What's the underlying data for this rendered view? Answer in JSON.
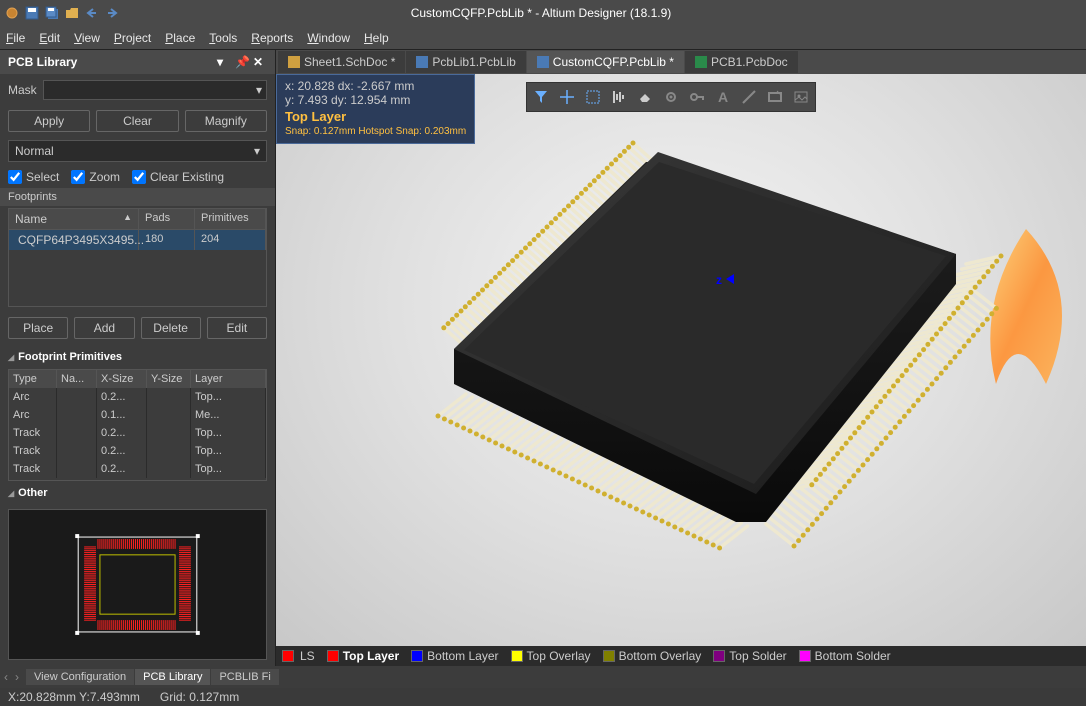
{
  "title_bar": {
    "title": "CustomCQFP.PcbLib * - Altium Designer (18.1.9)"
  },
  "menus": [
    "File",
    "Edit",
    "View",
    "Project",
    "Place",
    "Tools",
    "Reports",
    "Window",
    "Help"
  ],
  "panel": {
    "title": "PCB Library",
    "mask_label": "Mask",
    "apply": "Apply",
    "clear": "Clear",
    "magnify": "Magnify",
    "normal": "Normal",
    "select": "Select",
    "zoom": "Zoom",
    "clear_existing": "Clear Existing",
    "footprints_label": "Footprints",
    "columns": {
      "name": "Name",
      "pads": "Pads",
      "prims": "Primitives"
    },
    "footprint_row": {
      "name": "CQFP64P3495X3495...",
      "pads": "180",
      "prims": "204"
    },
    "actions": {
      "place": "Place",
      "add": "Add",
      "delete": "Delete",
      "edit": "Edit"
    },
    "prim_title": "Footprint Primitives",
    "prim_cols": {
      "type": "Type",
      "name": "Na...",
      "xsize": "X-Size",
      "ysize": "Y-Size",
      "layer": "Layer"
    },
    "prim_rows": [
      {
        "type": "Arc",
        "name": "",
        "xsize": "0.2...",
        "ysize": "",
        "layer": "Top..."
      },
      {
        "type": "Arc",
        "name": "",
        "xsize": "0.1...",
        "ysize": "",
        "layer": "Me..."
      },
      {
        "type": "Track",
        "name": "",
        "xsize": "0.2...",
        "ysize": "",
        "layer": "Top..."
      },
      {
        "type": "Track",
        "name": "",
        "xsize": "0.2...",
        "ysize": "",
        "layer": "Top..."
      },
      {
        "type": "Track",
        "name": "",
        "xsize": "0.2...",
        "ysize": "",
        "layer": "Top..."
      }
    ],
    "other_title": "Other"
  },
  "tabs": [
    {
      "label": "Sheet1.SchDoc *",
      "active": false
    },
    {
      "label": "PcbLib1.PcbLib",
      "active": false
    },
    {
      "label": "CustomCQFP.PcbLib *",
      "active": true
    },
    {
      "label": "PCB1.PcbDoc",
      "active": false
    }
  ],
  "info": {
    "line1": "x: 20.828    dx: -2.667   mm",
    "line2": "y:  7.493    dy: 12.954  mm",
    "top_layer": "Top Layer",
    "snap": "Snap: 0.127mm Hotspot Snap: 0.203mm"
  },
  "bottom_tabs": {
    "view_config": "View Configuration",
    "pcb_lib": "PCB Library",
    "pcblib_fi": "PCBLIB Fi"
  },
  "layers": {
    "ls": "LS",
    "items": [
      {
        "color": "#ff0000",
        "label": "Top Layer",
        "bold": true
      },
      {
        "color": "#0000ff",
        "label": "Bottom Layer"
      },
      {
        "color": "#ffff00",
        "label": "Top Overlay"
      },
      {
        "color": "#808000",
        "label": "Bottom Overlay"
      },
      {
        "color": "#800080",
        "label": "Top Solder"
      },
      {
        "color": "#ff00ff",
        "label": "Bottom Solder"
      }
    ]
  },
  "status": {
    "xy": "X:20.828mm Y:7.493mm",
    "grid": "Grid: 0.127mm"
  },
  "icons": {
    "save": "💾",
    "open": "📂",
    "undo": "↶",
    "redo": "↷"
  }
}
